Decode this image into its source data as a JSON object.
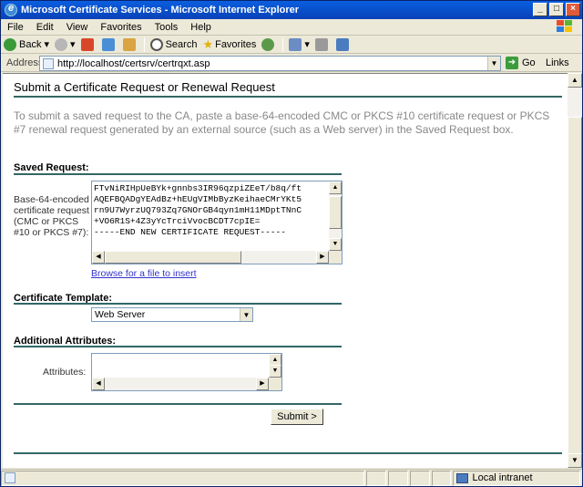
{
  "window": {
    "title": "Microsoft Certificate Services - Microsoft Internet Explorer"
  },
  "menu": [
    "File",
    "Edit",
    "View",
    "Favorites",
    "Tools",
    "Help"
  ],
  "toolbar": {
    "back": "Back",
    "search": "Search",
    "favorites": "Favorites"
  },
  "address": {
    "label": "Address",
    "url": "http://localhost/certsrv/certrqxt.asp",
    "go": "Go",
    "links": "Links"
  },
  "page": {
    "heading": "Submit a Certificate Request or Renewal Request",
    "intro": "To submit a saved request to the CA, paste a base-64-encoded CMC or PKCS #10 certificate request or PKCS #7 renewal request generated by an external source (such as a Web server) in the Saved Request box.",
    "saved_request_title": "Saved Request:",
    "saved_request_label": "Base-64-encoded certificate request (CMC or PKCS #10 or PKCS #7):",
    "request_text": "FTvNiRIHpUeBYk+gnnbs3IR96qzpiZEeT/b8q/ft\nAQEFBQADgYEAdBz+hEUgVIMbByzKeihaeCMrYKt5\nrn9U7WyrzUQ793Zq7GNOrGB4qyn1mH11MDptTNnC\n+VO6R1S+4Z3yYcTrciVvocBCDT7cpIE=\n-----END NEW CERTIFICATE REQUEST-----",
    "browse_link": "Browse for a file to insert",
    "template_title": "Certificate Template:",
    "template_value": "Web Server",
    "attributes_title": "Additional Attributes:",
    "attributes_label": "Attributes:",
    "submit": "Submit >"
  },
  "status": {
    "zone": "Local intranet"
  }
}
